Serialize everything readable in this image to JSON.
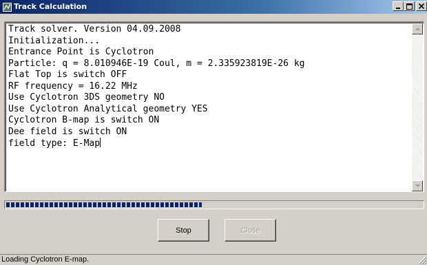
{
  "window": {
    "title": "Track Calculation",
    "title_buttons": [
      "minimize",
      "maximize",
      "close"
    ]
  },
  "log": {
    "lines": [
      "Track solver. Version 04.09.2008",
      "Initialization...",
      "Entrance Point is Cyclotron",
      "Particle: q = 8.010946E-19 Coul, m = 2.335923819E-26 kg",
      "Flat Top is switch OFF",
      "RF frequency = 16.22 MHz",
      "Use Cyclotron 3DS geometry NO",
      "Use Cyclotron Analytical geometry YES",
      "Cyclotron B-map is switch ON",
      "Dee field is switch ON",
      "field type: E-Map"
    ]
  },
  "progress": {
    "fraction": 0.47
  },
  "buttons": {
    "stop_label": "Stop",
    "close_label": "Close",
    "close_enabled": false
  },
  "status": {
    "text": "Loading Cyclotron E-map."
  },
  "icons": {
    "app": "app-icon",
    "minimize": "minimize-icon",
    "maximize": "maximize-icon",
    "close": "close-icon",
    "scroll_up": "scroll-up-arrow-icon",
    "scroll_down": "scroll-down-arrow-icon",
    "grip": "resize-grip-icon"
  },
  "colors": {
    "titlebar_start": "#0a246a",
    "titlebar_end": "#a6caf0",
    "progress": "#0a246a",
    "face": "#d4d0c8"
  }
}
